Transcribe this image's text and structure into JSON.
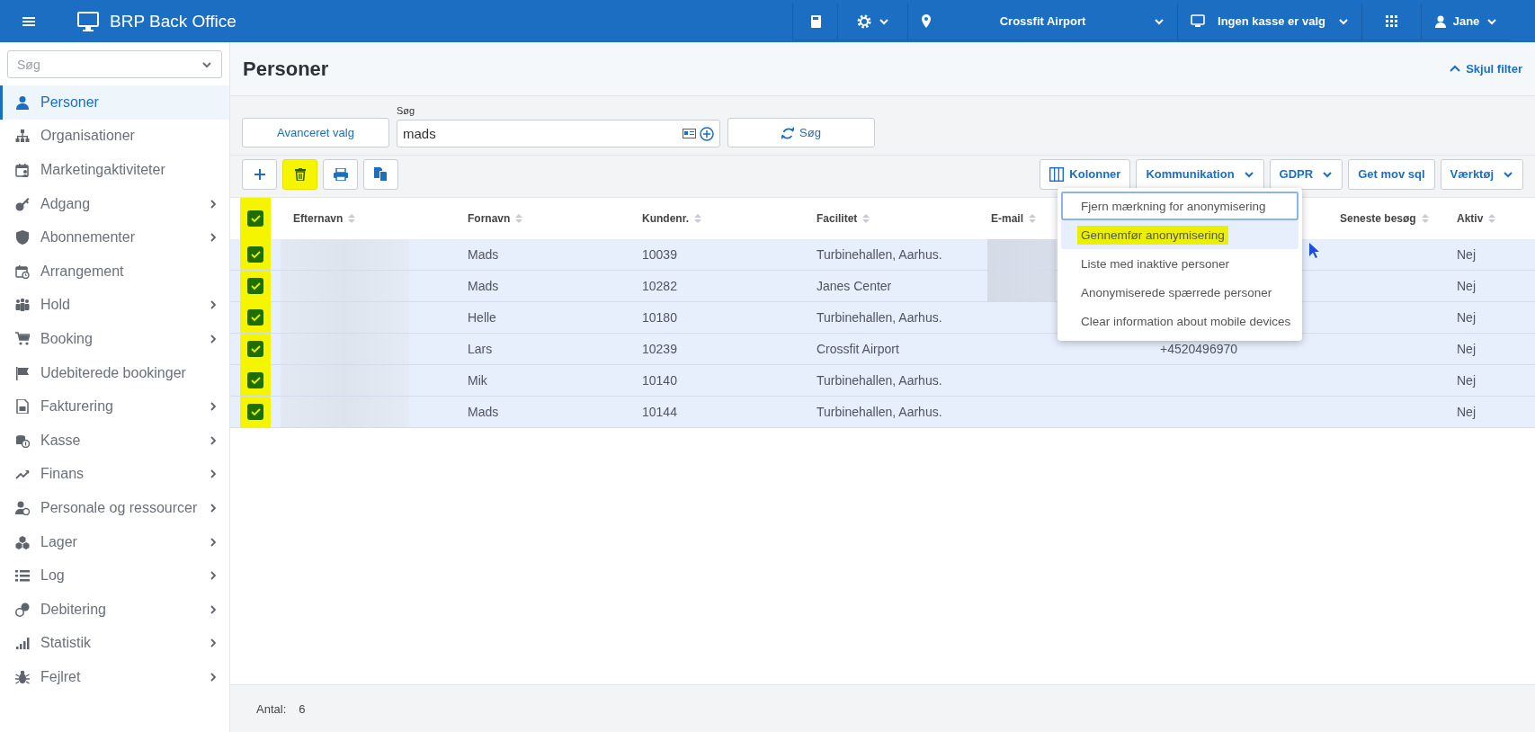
{
  "topbar": {
    "title": "BRP Back Office",
    "location": "Crossfit Airport",
    "register": "Ingen kasse er valg",
    "user": "Jane"
  },
  "sidebar": {
    "search_placeholder": "Søg",
    "items": [
      {
        "label": "Personer",
        "selected": true,
        "has_submenu": false
      },
      {
        "label": "Organisationer",
        "selected": false,
        "has_submenu": false
      },
      {
        "label": "Marketingaktiviteter",
        "selected": false,
        "has_submenu": false
      },
      {
        "label": "Adgang",
        "selected": false,
        "has_submenu": true
      },
      {
        "label": "Abonnementer",
        "selected": false,
        "has_submenu": true
      },
      {
        "label": "Arrangement",
        "selected": false,
        "has_submenu": false
      },
      {
        "label": "Hold",
        "selected": false,
        "has_submenu": true
      },
      {
        "label": "Booking",
        "selected": false,
        "has_submenu": true
      },
      {
        "label": "Udebiterede bookinger",
        "selected": false,
        "has_submenu": false
      },
      {
        "label": "Fakturering",
        "selected": false,
        "has_submenu": true
      },
      {
        "label": "Kasse",
        "selected": false,
        "has_submenu": true
      },
      {
        "label": "Finans",
        "selected": false,
        "has_submenu": true
      },
      {
        "label": "Personale og ressourcer",
        "selected": false,
        "has_submenu": true
      },
      {
        "label": "Lager",
        "selected": false,
        "has_submenu": true
      },
      {
        "label": "Log",
        "selected": false,
        "has_submenu": true
      },
      {
        "label": "Debitering",
        "selected": false,
        "has_submenu": true
      },
      {
        "label": "Statistik",
        "selected": false,
        "has_submenu": true
      },
      {
        "label": "Fejlret",
        "selected": false,
        "has_submenu": true
      }
    ]
  },
  "page": {
    "title": "Personer",
    "filter_toggle": "Skjul filter"
  },
  "filter": {
    "advanced_button": "Avanceret valg",
    "search_label": "Søg",
    "search_value": "mads",
    "search_button": "Søg"
  },
  "toolbar": {
    "left": [
      {
        "kind": "add",
        "highlighted": false
      },
      {
        "kind": "delete",
        "highlighted": true
      },
      {
        "kind": "print",
        "highlighted": false
      },
      {
        "kind": "copy",
        "highlighted": false
      }
    ],
    "right": [
      {
        "kind": "columns",
        "label": "Kolonner"
      },
      {
        "kind": "dropdown",
        "label": "Kommunikation"
      },
      {
        "kind": "dropdown",
        "label": "GDPR"
      },
      {
        "kind": "plain",
        "label": "Get mov sql"
      },
      {
        "kind": "dropdown",
        "label": "Værktøj"
      }
    ]
  },
  "table": {
    "select_all_checked": true,
    "checkbox_column_highlighted": true,
    "columns": [
      "Efternavn",
      "Fornavn",
      "Kundenr.",
      "Facilitet",
      "E-mail",
      "Seneste besøg",
      "Aktiv"
    ],
    "rows": [
      {
        "checked": true,
        "surname_redacted": true,
        "first_name": "Mads",
        "customer_no": "10039",
        "facility": "Turbinehallen, Aarhus.",
        "email_redacted": true,
        "active": "Nej"
      },
      {
        "checked": true,
        "surname_redacted": true,
        "first_name": "Mads",
        "customer_no": "10282",
        "facility": "Janes Center",
        "email_redacted": true,
        "active": "Nej"
      },
      {
        "checked": true,
        "surname_redacted": true,
        "first_name": "Helle",
        "customer_no": "10180",
        "facility": "Turbinehallen, Aarhus.",
        "email_redacted": false,
        "active": "Nej"
      },
      {
        "checked": true,
        "surname_redacted": true,
        "first_name": "Lars",
        "customer_no": "10239",
        "facility": "Crossfit Airport",
        "email_redacted": false,
        "column_6": "+4520496970",
        "active": "Nej"
      },
      {
        "checked": true,
        "surname_redacted": true,
        "first_name": "Mik",
        "customer_no": "10140",
        "facility": "Turbinehallen, Aarhus.",
        "email_redacted": false,
        "active": "Nej"
      },
      {
        "checked": true,
        "surname_redacted": true,
        "first_name": "Mads",
        "customer_no": "10144",
        "facility": "Turbinehallen, Aarhus.",
        "email_redacted": false,
        "active": "Nej"
      }
    ]
  },
  "gdpr_menu": {
    "items": [
      {
        "label": "Fjern mærkning for anonymisering",
        "focused": true,
        "hovered": false,
        "highlighted": false
      },
      {
        "label": "Gennemfør anonymisering",
        "focused": false,
        "hovered": true,
        "highlighted": true
      },
      {
        "label": "Liste med inaktive personer",
        "focused": false,
        "hovered": false,
        "highlighted": false
      },
      {
        "label": "Anonymiserede spærrede personer",
        "focused": false,
        "hovered": false,
        "highlighted": false
      },
      {
        "label": "Clear information about mobile devices",
        "focused": false,
        "hovered": false,
        "highlighted": false
      }
    ]
  },
  "footer": {
    "label": "Antal:",
    "count": "6"
  }
}
